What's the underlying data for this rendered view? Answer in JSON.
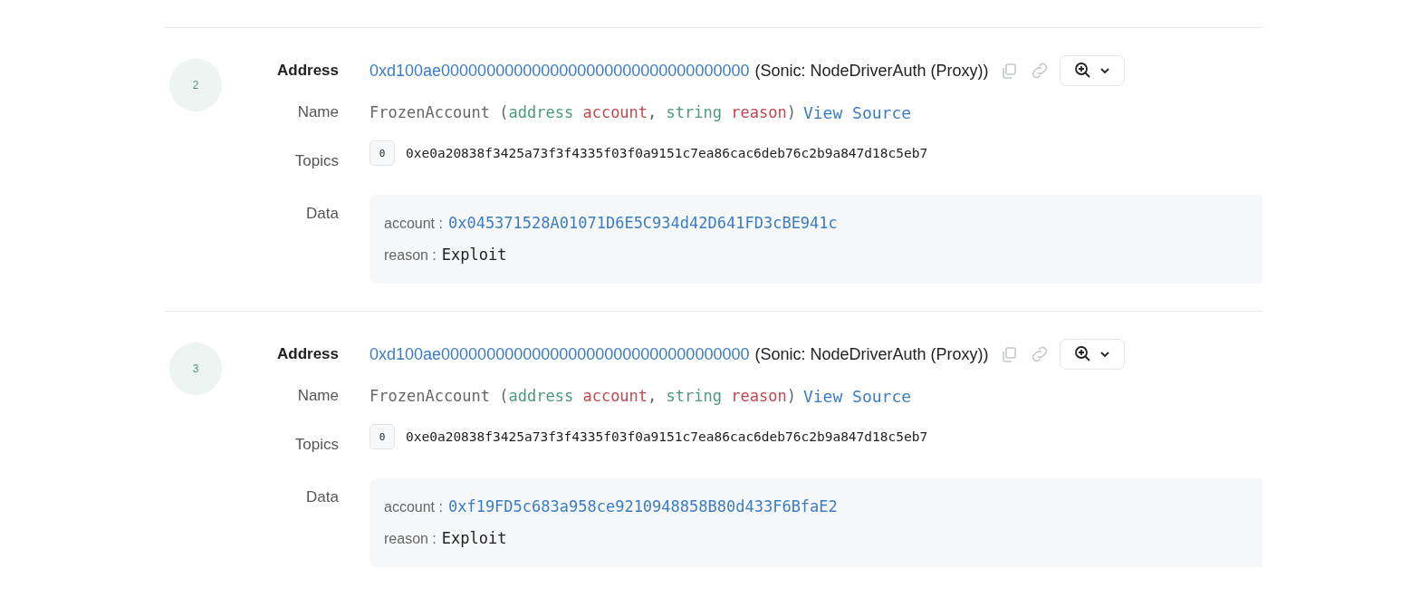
{
  "logs": [
    {
      "index": "2",
      "address": "0xd100ae0000000000000000000000000000000000",
      "address_name": "(Sonic: NodeDriverAuth (Proxy))",
      "labels": {
        "address": "Address",
        "name": "Name",
        "topics": "Topics",
        "data": "Data"
      },
      "signature": [
        {
          "kind": "plain",
          "text": "FrozenAccount ("
        },
        {
          "kind": "type",
          "text": "address "
        },
        {
          "kind": "param",
          "text": "account"
        },
        {
          "kind": "plain",
          "text": ", "
        },
        {
          "kind": "type",
          "text": "string "
        },
        {
          "kind": "param",
          "text": "reason"
        },
        {
          "kind": "plain",
          "text": ")"
        }
      ],
      "view_source": "View Source",
      "topics": [
        {
          "index": "0",
          "value": "0xe0a20838f3425a73f3f4335f03f0a9151c7ea86cac6deb76c2b9a847d18c5eb7"
        }
      ],
      "data": [
        {
          "key": "account :",
          "kind": "address",
          "value": "0x045371528A01071D6E5C934d42D641FD3cBE941c"
        },
        {
          "key": "reason :",
          "kind": "text",
          "value": "Exploit"
        }
      ]
    },
    {
      "index": "3",
      "address": "0xd100ae0000000000000000000000000000000000",
      "address_name": "(Sonic: NodeDriverAuth (Proxy))",
      "labels": {
        "address": "Address",
        "name": "Name",
        "topics": "Topics",
        "data": "Data"
      },
      "signature": [
        {
          "kind": "plain",
          "text": "FrozenAccount ("
        },
        {
          "kind": "type",
          "text": "address "
        },
        {
          "kind": "param",
          "text": "account"
        },
        {
          "kind": "plain",
          "text": ", "
        },
        {
          "kind": "type",
          "text": "string "
        },
        {
          "kind": "param",
          "text": "reason"
        },
        {
          "kind": "plain",
          "text": ")"
        }
      ],
      "view_source": "View Source",
      "topics": [
        {
          "index": "0",
          "value": "0xe0a20838f3425a73f3f4335f03f0a9151c7ea86cac6deb76c2b9a847d18c5eb7"
        }
      ],
      "data": [
        {
          "key": "account :",
          "kind": "address",
          "value": "0xf19FD5c683a958ce9210948858B80d433F6BfaE2"
        },
        {
          "key": "reason :",
          "kind": "text",
          "value": "Exploit"
        }
      ]
    }
  ]
}
